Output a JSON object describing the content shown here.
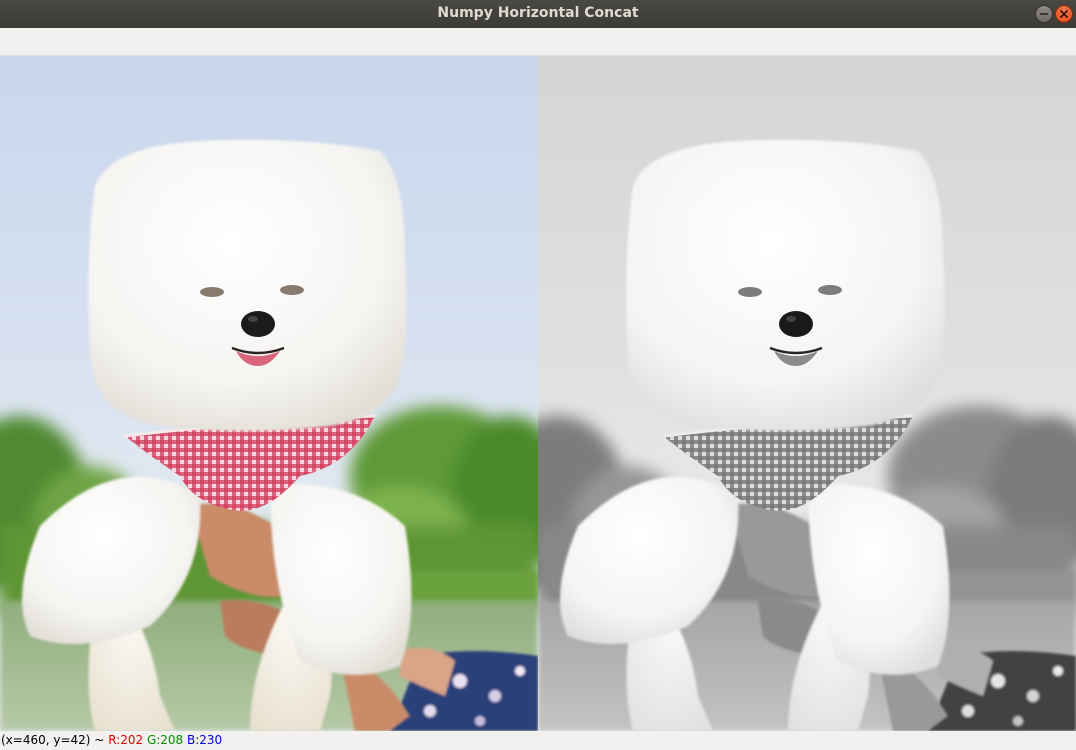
{
  "window": {
    "title": "Numpy Horizontal Concat"
  },
  "status": {
    "coords": "(x=460, y=42) ~",
    "r": "R:202",
    "g": "G:208",
    "b": "B:230"
  },
  "colors": {
    "titlebar": "#3c3b37",
    "title_text": "#dfdbd2",
    "close_button": "#e95420",
    "status_r": "#e00000",
    "status_g": "#009000",
    "status_b": "#0000e0"
  },
  "images": [
    {
      "id": "color-image",
      "mode": "color"
    },
    {
      "id": "grayscale-image",
      "mode": "grayscale"
    }
  ]
}
